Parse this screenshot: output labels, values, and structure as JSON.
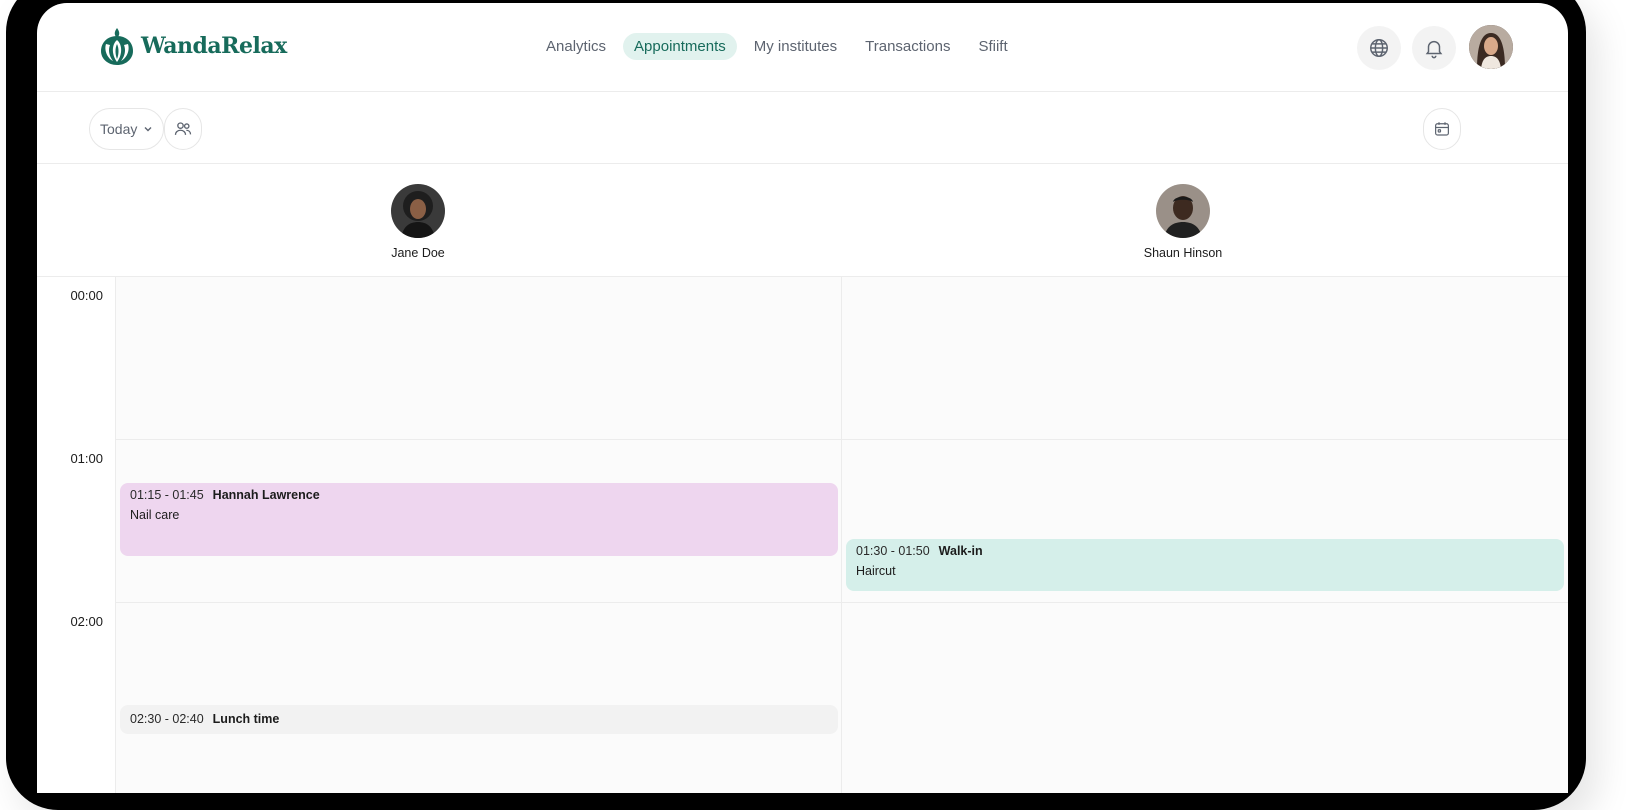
{
  "brand": {
    "name": "WandaRelax",
    "color": "#176b5b"
  },
  "nav": {
    "items": [
      {
        "label": "Analytics",
        "active": false
      },
      {
        "label": "Appointments",
        "active": true
      },
      {
        "label": "My institutes",
        "active": false
      },
      {
        "label": "Transactions",
        "active": false
      },
      {
        "label": "Sfiift",
        "active": false
      }
    ]
  },
  "header_actions": {
    "language_icon": "globe-icon",
    "notifications_icon": "bell-icon",
    "profile_icon": "avatar"
  },
  "toolbar": {
    "date_filter": "Today",
    "staff_filter_icon": "users-icon",
    "calendar_icon": "calendar-icon"
  },
  "staff": [
    {
      "name": "Jane Doe"
    },
    {
      "name": "Shaun Hinson"
    }
  ],
  "timeline": {
    "hours": [
      "00:00",
      "01:00",
      "02:00"
    ]
  },
  "appointments": [
    {
      "staff": "Jane Doe",
      "time": "01:15 - 01:45",
      "client": "Hannah Lawrence",
      "service": "Nail care",
      "color": "#eed6ef"
    },
    {
      "staff": "Shaun Hinson",
      "time": "01:30 - 01:50",
      "client": "Walk-in",
      "service": "Haircut",
      "color": "#d5efea"
    },
    {
      "staff": "Jane Doe",
      "time": "02:30 - 02:40",
      "client": "Lunch time",
      "service": "",
      "color": "#f2f2f2"
    }
  ]
}
